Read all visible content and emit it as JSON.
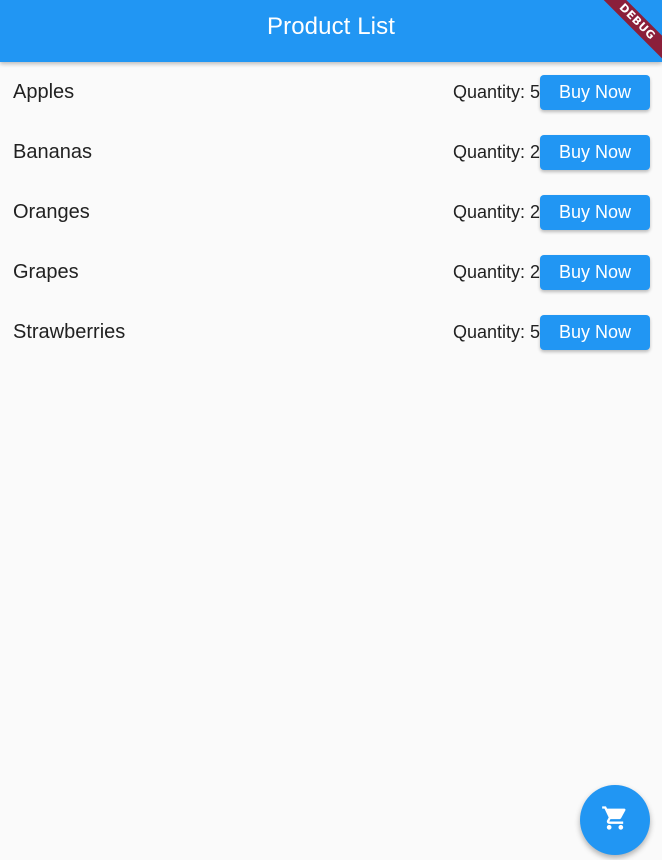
{
  "app_bar": {
    "title": "Product List",
    "color": "#2196f3"
  },
  "debug_banner": {
    "label": "DEBUG"
  },
  "products": [
    {
      "name": "Apples",
      "quantity_label": "Quantity: 5",
      "button_label": "Buy Now"
    },
    {
      "name": "Bananas",
      "quantity_label": "Quantity: 2",
      "button_label": "Buy Now"
    },
    {
      "name": "Oranges",
      "quantity_label": "Quantity: 2",
      "button_label": "Buy Now"
    },
    {
      "name": "Grapes",
      "quantity_label": "Quantity: 2",
      "button_label": "Buy Now"
    },
    {
      "name": "Strawberries",
      "quantity_label": "Quantity: 5",
      "button_label": "Buy Now"
    }
  ],
  "fab": {
    "icon": "shopping-cart-icon"
  }
}
